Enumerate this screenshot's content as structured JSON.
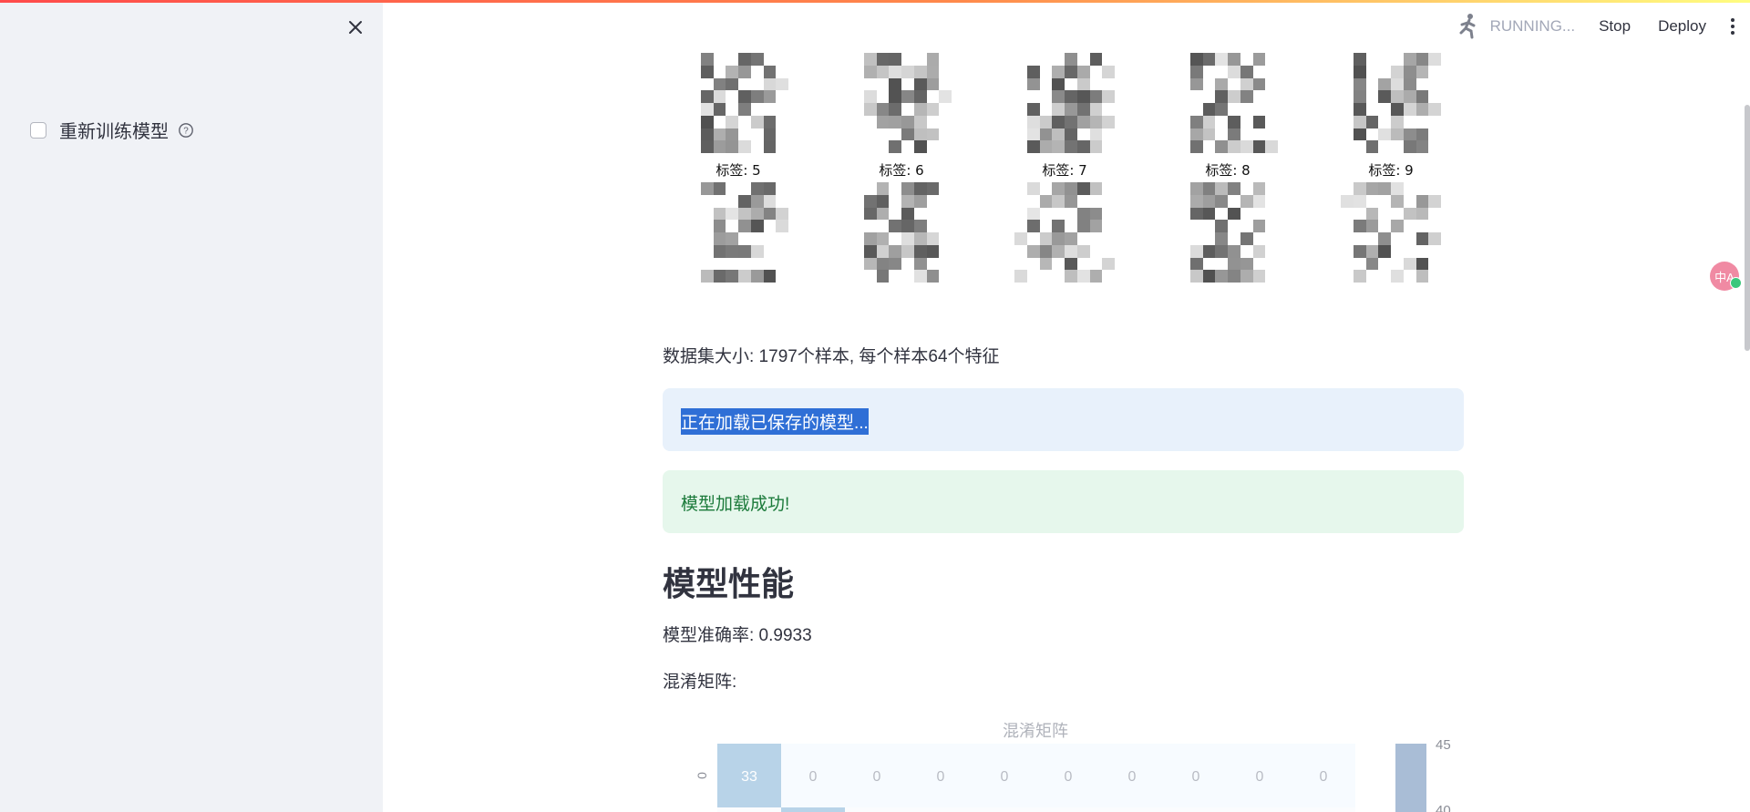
{
  "sidebar": {
    "checkbox_label": "重新训练模型",
    "checked": false
  },
  "header": {
    "status": "RUNNING...",
    "stop_label": "Stop",
    "deploy_label": "Deploy"
  },
  "digits": {
    "labels": [
      "标签: 5",
      "标签: 6",
      "标签: 7",
      "标签: 8",
      "标签: 9"
    ]
  },
  "dataset_info": "数据集大小: 1797个样本, 每个样本64个特征",
  "alert_info": "正在加载已保存的模型...",
  "alert_success": "模型加载成功!",
  "section_title": "模型性能",
  "accuracy_text": "模型准确率: 0.9933",
  "confusion_label": "混淆矩阵:",
  "chart_data": {
    "type": "heatmap",
    "title": "混淆矩阵",
    "y_tick_labels": [
      "0"
    ],
    "rows": [
      [
        33,
        0,
        0,
        0,
        0,
        0,
        0,
        0,
        0,
        0
      ]
    ],
    "colorbar_ticks": [
      "45",
      "40"
    ],
    "colors": {
      "high": "#b8d3e8",
      "low": "#f7fbff"
    }
  },
  "colors": {
    "sidebar_bg": "#f0f2f6",
    "info_bg": "#e8f1fb",
    "success_bg": "#e6f7ec",
    "success_text": "#1b7a3a",
    "selection": "#2f6fd6"
  }
}
